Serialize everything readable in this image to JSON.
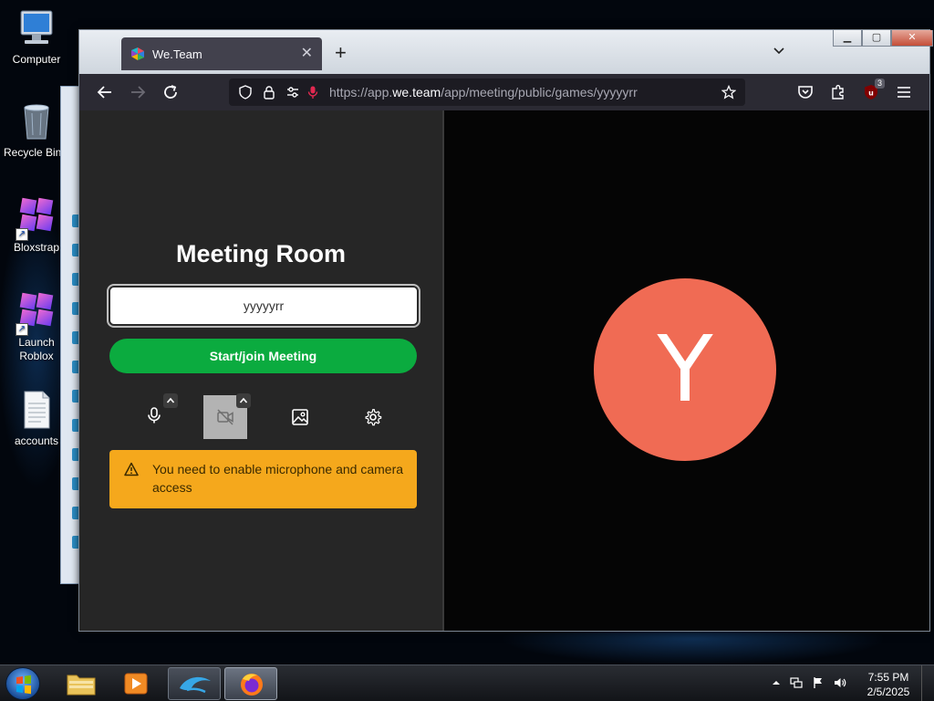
{
  "desktop": {
    "icons": [
      {
        "label": "Computer"
      },
      {
        "label": "Recycle Bin"
      },
      {
        "label": "Bloxstrap"
      },
      {
        "label": "Launch Roblox"
      },
      {
        "label": "accounts"
      }
    ]
  },
  "browser": {
    "tab": {
      "title": "We.Team",
      "icon": "weteam-favicon"
    },
    "window_controls": [
      "minimize",
      "maximize",
      "close"
    ],
    "url": {
      "prefix": "https://app.",
      "host": "we.team",
      "path": "/app/meeting/public/games/yyyyyrr"
    },
    "extension_badge": "3"
  },
  "meeting": {
    "title": "Meeting Room",
    "room_input_value": "yyyyyrr",
    "join_label": "Start/join Meeting",
    "controls": [
      "microphone-icon",
      "camera-off-icon",
      "background-image-icon",
      "settings-gear-icon"
    ],
    "warning_text": "You need to enable microphone and camera access"
  },
  "preview": {
    "avatar_letter": "Y",
    "avatar_color": "#f06b54"
  },
  "taskbar": {
    "time": "7:55 PM",
    "date": "2/5/2025",
    "apps": [
      "explorer",
      "media-player",
      "dolphin",
      "firefox"
    ]
  }
}
